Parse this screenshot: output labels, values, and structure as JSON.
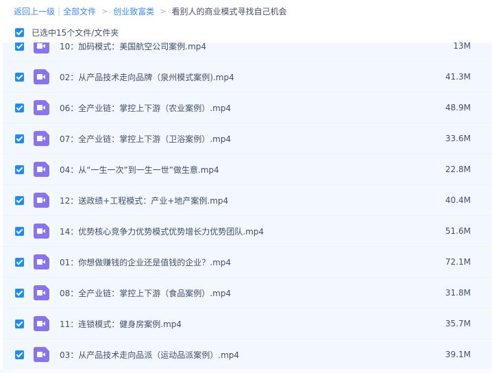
{
  "breadcrumb": {
    "back": "返回上一级",
    "all_files": "全部文件",
    "category": "创业致富类",
    "current": "看别人的商业模式寻找自己机会"
  },
  "selection": {
    "label": "已选中15个文件/文件夹"
  },
  "files": [
    {
      "name": "10：加码模式：美国航空公司案例.mp4",
      "size": "13M"
    },
    {
      "name": "02：从产品技术走向品牌（泉州模式案例).mp4",
      "size": "41.3M"
    },
    {
      "name": "06：全产业链：掌控上下游（农业案例）.mp4",
      "size": "48.9M"
    },
    {
      "name": "07：全产业链：掌控上下游（卫浴案例）.mp4",
      "size": "33.6M"
    },
    {
      "name": "04：从“一生一次”到一生一世”做生意.mp4",
      "size": "22.8M"
    },
    {
      "name": "12：送政绩+工程模式：产业+地产案例.mp4",
      "size": "40.4M"
    },
    {
      "name": "14：优势核心竞争力优势模式优势增长力优势团队.mp4",
      "size": "51.6M"
    },
    {
      "name": "01：你想做赚钱的企业还是值钱的企业？.mp4",
      "size": "72.1M"
    },
    {
      "name": "08：全产业链：掌控上下游（食品案例）.mp4",
      "size": "31.8M"
    },
    {
      "name": "11：连锁模式：健身房案例.mp4",
      "size": "35.7M"
    },
    {
      "name": "03：从产品技术走向品派（运动品派案例）.mp4",
      "size": "39.1M"
    }
  ]
}
